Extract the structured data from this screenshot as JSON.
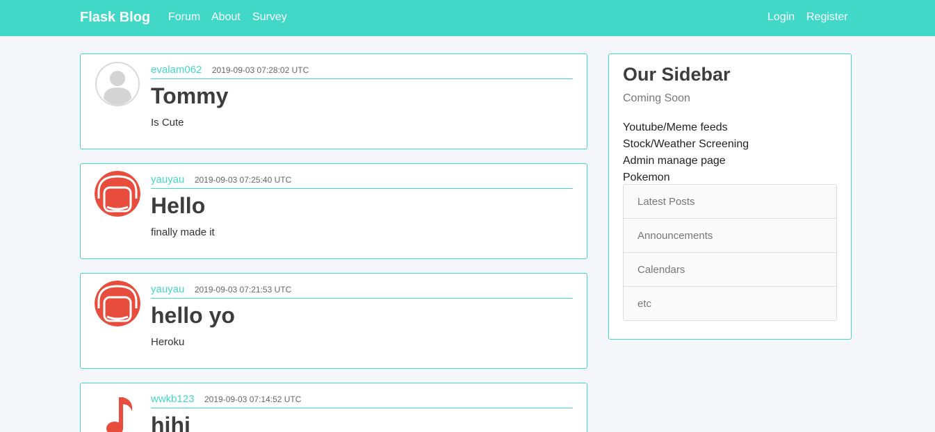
{
  "navbar": {
    "brand": "Flask Blog",
    "links": [
      "Forum",
      "About",
      "Survey"
    ],
    "right_links": [
      "Login",
      "Register"
    ]
  },
  "posts": [
    {
      "author": "evalam062",
      "date": "2019-09-03 07:28:02 UTC",
      "title": "Tommy",
      "content": "Is Cute",
      "avatar": "default-user-icon"
    },
    {
      "author": "yauyau",
      "date": "2019-09-03 07:25:40 UTC",
      "title": "Hello",
      "content": "finally made it",
      "avatar": "red-helmet-icon"
    },
    {
      "author": "yauyau",
      "date": "2019-09-03 07:21:53 UTC",
      "title": "hello yo",
      "content": "Heroku",
      "avatar": "red-helmet-icon"
    },
    {
      "author": "wwkb123",
      "date": "2019-09-03 07:14:52 UTC",
      "title": "hihi",
      "content": "",
      "avatar": "music-note-icon"
    }
  ],
  "sidebar": {
    "title": "Our Sidebar",
    "subtitle": "Coming Soon",
    "items": [
      "Youtube/Meme feeds",
      "Stock/Weather Screening",
      "Admin manage page",
      "Pokemon"
    ],
    "list_group": [
      "Latest Posts",
      "Announcements",
      "Calendars",
      "etc"
    ]
  },
  "colors": {
    "accent": "#41d8c8",
    "background": "#f5f6f9",
    "avatar_red": "#e84c3d"
  }
}
